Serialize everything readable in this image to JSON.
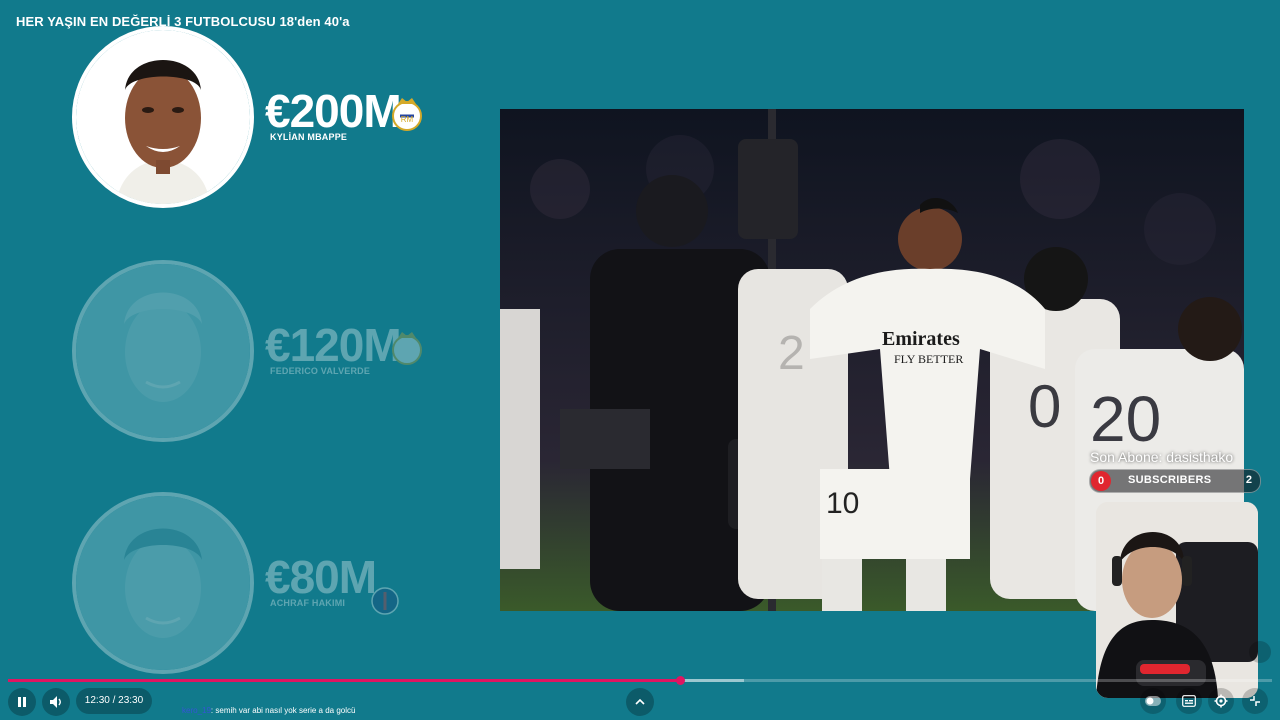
{
  "video": {
    "title": "HER YAŞIN EN DEĞERLİ 3 FUTBOLCUSU 18'den 40'a"
  },
  "players": [
    {
      "value": "€200M",
      "name": "KYLİAN MBAPPE",
      "club_icon": "real-madrid-crest",
      "highlighted": true
    },
    {
      "value": "€120M",
      "name": "FEDERICO VALVERDE",
      "club_icon": "real-madrid-crest",
      "highlighted": false
    },
    {
      "value": "€80M",
      "name": "ACHRAF HAKIMI",
      "club_icon": "psg-crest",
      "highlighted": false
    }
  ],
  "photo": {
    "jersey_sponsor_line1": "Emirates",
    "jersey_sponsor_line2": "FLY BETTER",
    "jersey_numbers": [
      "20",
      "10",
      "0",
      "2"
    ]
  },
  "overlay": {
    "last_subscriber_label": "Son Abone: dasisthako",
    "subscribers_label": "SUBSCRIBERS",
    "subscribers_left": "0",
    "subscribers_right": "2"
  },
  "player_controls": {
    "time": "12:30 / 23:30",
    "progress": 0.532,
    "buffered": 0.583,
    "chat_user": "kero_19",
    "chat_message": ": semih var abi nasıl yok serie a da golcü"
  },
  "colors": {
    "background": "#117a8c",
    "progress": "#e01561",
    "subscriber_badge": "#e0262f"
  }
}
